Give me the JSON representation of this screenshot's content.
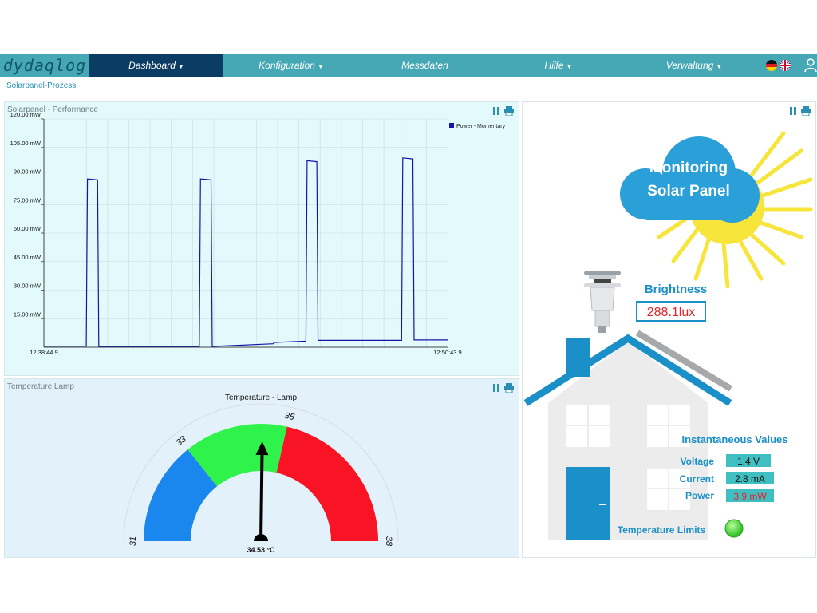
{
  "app": {
    "logo": "dydaqlog"
  },
  "nav": {
    "items": [
      {
        "label": "Dashboard",
        "caret": "▼"
      },
      {
        "label": "Konfiguration",
        "caret": "▼"
      },
      {
        "label": "Messdaten",
        "caret": ""
      },
      {
        "label": "Hilfe",
        "caret": "▼"
      },
      {
        "label": "Verwaltung",
        "caret": "▼"
      }
    ]
  },
  "breadcrumb": "Solarpanel-Prozess",
  "solar_panel": {
    "title": "Solarpanel - Performance",
    "legend": "Power - Momentary"
  },
  "chart_data": {
    "type": "line",
    "title": "",
    "xlabel": "",
    "ylabel": "",
    "x_ticks": [
      "12:38:44.9",
      "12:50:43.9"
    ],
    "y_ticks": [
      "15.00 mW",
      "30.00 mW",
      "45.00 mW",
      "60.00 mW",
      "75.00 mW",
      "90.00 mW",
      "105.00 mW",
      "120.00 mW"
    ],
    "ylim": [
      0,
      120
    ],
    "xlim": [
      0,
      100
    ],
    "grid": true,
    "legend_position": "top-right",
    "series": [
      {
        "name": "Power - Momentary",
        "color": "#1515a8",
        "x": [
          0,
          10.5,
          10.8,
          13.3,
          13.6,
          38.5,
          38.8,
          41.4,
          41.7,
          56.8,
          57.1,
          64.9,
          65.2,
          67.6,
          67.9,
          88.6,
          88.9,
          91.4,
          91.7,
          100
        ],
        "y": [
          0.6,
          0.6,
          88.5,
          88,
          0.4,
          0.4,
          88.5,
          88,
          0.4,
          1.8,
          2.5,
          3.2,
          98,
          97.5,
          3.6,
          3.6,
          99.5,
          99,
          3.8,
          3.8
        ]
      }
    ]
  },
  "temperature": {
    "title": "Temperature Lamp",
    "gauge_title": "Temperature - Lamp",
    "value": 34.53,
    "value_label": "34.53 °C",
    "min": 31,
    "max": 38,
    "tick_labels": [
      "31",
      "33",
      "35",
      "38"
    ],
    "bands": [
      {
        "from": 31,
        "to": 33,
        "color": "#1a87ee"
      },
      {
        "from": 33,
        "to": 35,
        "color": "#2ff24a"
      },
      {
        "from": 35,
        "to": 38,
        "color": "#f81425"
      }
    ]
  },
  "monitor": {
    "cloud_line1": "Monitoring",
    "cloud_line2": "Solar Panel",
    "brightness_label": "Brightness",
    "brightness_value": "288.1lux",
    "inst_title": "Instantaneous Values",
    "voltage_label": "Voltage",
    "voltage_value": "1.4 V",
    "current_label": "Current",
    "current_value": "2.8 mA",
    "power_label": "Power",
    "power_value": "3.9 mW",
    "templimit_label": "Temperature Limits",
    "templimit_status_color": "#3cd62e"
  },
  "colors": {
    "nav": "#45a8b4",
    "nav_active": "#0b3c63",
    "accent": "#1a8fc8",
    "sun": "#f7e53c",
    "cloud": "#2b9fd8",
    "house": "#ececec",
    "roof": "#1a8fc8"
  },
  "icons": {
    "pause": "pause-icon",
    "print": "printer-icon",
    "flag_de": "flag-de-icon",
    "flag_uk": "flag-uk-icon",
    "user": "user-icon"
  }
}
